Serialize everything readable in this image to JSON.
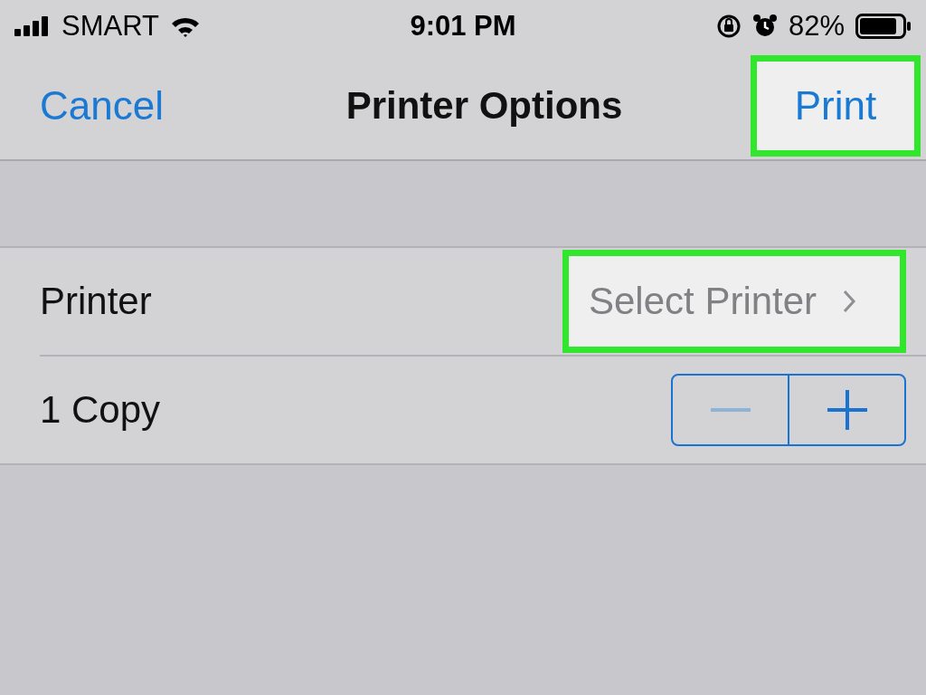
{
  "status_bar": {
    "carrier": "SMART",
    "time": "9:01 PM",
    "battery": "82%"
  },
  "nav": {
    "cancel": "Cancel",
    "title": "Printer Options",
    "print": {
      "label": "Print",
      "highlighted": true
    }
  },
  "rows": [
    {
      "kind": "link",
      "label": "Printer",
      "value": "Select Printer",
      "highlighted": true
    },
    {
      "kind": "stepper",
      "label": "1 Copy",
      "decrement_disabled": true
    }
  ]
}
